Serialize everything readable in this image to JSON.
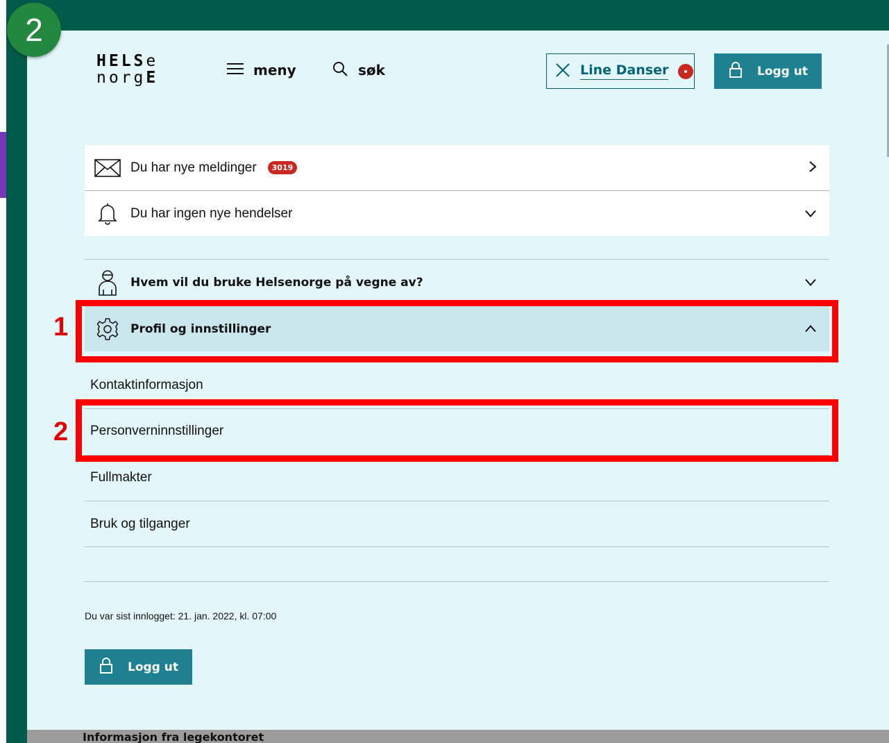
{
  "step_badge": "2",
  "logo": {
    "line1": "HELSe",
    "line2": "norgE"
  },
  "header": {
    "menu_label": "meny",
    "search_label": "søk",
    "user_name": "Line Danser",
    "logout_label": "Logg ut"
  },
  "notifications": {
    "messages_label": "Du har nye meldinger",
    "messages_count": "3019",
    "events_label": "Du har ingen nye hendelser"
  },
  "sections": {
    "represent_label": "Hvem vil du bruke Helsenorge på vegne av?",
    "profile_label": "Profil og innstillinger"
  },
  "profile_items": [
    "Kontaktinformasjon",
    "Personverninnstillinger",
    "Fullmakter",
    "Bruk og tilganger"
  ],
  "last_login": "Du var sist innlogget: 21. jan. 2022, kl. 07:00",
  "footer_logout_label": "Logg ut",
  "bottom_bar_text": "Informasjon fra legekontoret",
  "annotations": {
    "box1": "1",
    "box2": "2"
  },
  "colors": {
    "frame": "#015b49",
    "panel": "#e3f6f9",
    "accent": "#1e8191",
    "highlight": "#ff0000",
    "badge": "#c8281f"
  }
}
